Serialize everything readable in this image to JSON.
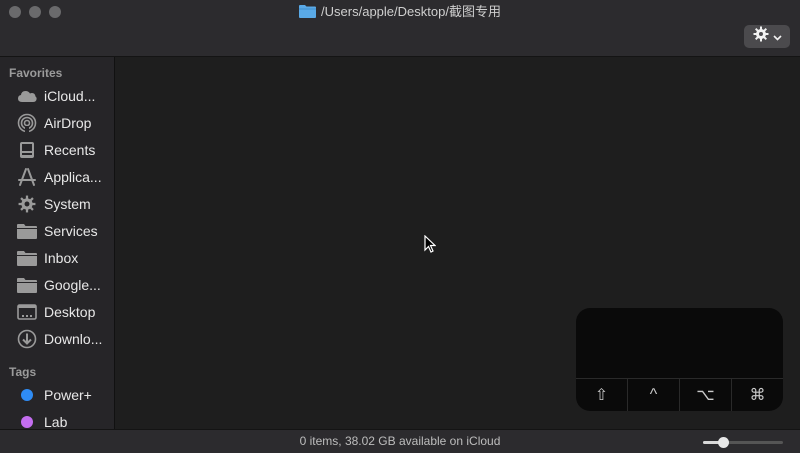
{
  "window": {
    "title": "/Users/apple/Desktop/截图专用"
  },
  "sidebar": {
    "favorites_label": "Favorites",
    "favorites": [
      {
        "label": "iCloud...",
        "icon": "cloud-icon"
      },
      {
        "label": "AirDrop",
        "icon": "airdrop-icon"
      },
      {
        "label": "Recents",
        "icon": "recents-icon"
      },
      {
        "label": "Applica...",
        "icon": "applications-icon"
      },
      {
        "label": "System",
        "icon": "gear-icon"
      },
      {
        "label": "Services",
        "icon": "folder-icon"
      },
      {
        "label": "Inbox",
        "icon": "folder-icon"
      },
      {
        "label": "Google...",
        "icon": "folder-icon"
      },
      {
        "label": "Desktop",
        "icon": "desktop-icon"
      },
      {
        "label": "Downlo...",
        "icon": "downloads-icon"
      }
    ],
    "tags_label": "Tags",
    "tags": [
      {
        "label": "Power+",
        "color": "#2f8cf5"
      },
      {
        "label": "Lab",
        "color": "#c46ef0"
      }
    ]
  },
  "keypad": {
    "keys": [
      {
        "glyph": "⇧",
        "icon": "shift-key-icon"
      },
      {
        "glyph": "^",
        "icon": "control-key-icon"
      },
      {
        "glyph": "⌥",
        "icon": "option-key-icon"
      },
      {
        "glyph": "⌘",
        "icon": "command-key-icon"
      }
    ]
  },
  "status": {
    "text": "0 items, 38.02 GB available on iCloud",
    "zoom_level": 0.25
  },
  "colors": {
    "folder_accent": "#5aa9e6",
    "window_bg": "#1e1e1e",
    "sidebar_bg": "#262528"
  }
}
